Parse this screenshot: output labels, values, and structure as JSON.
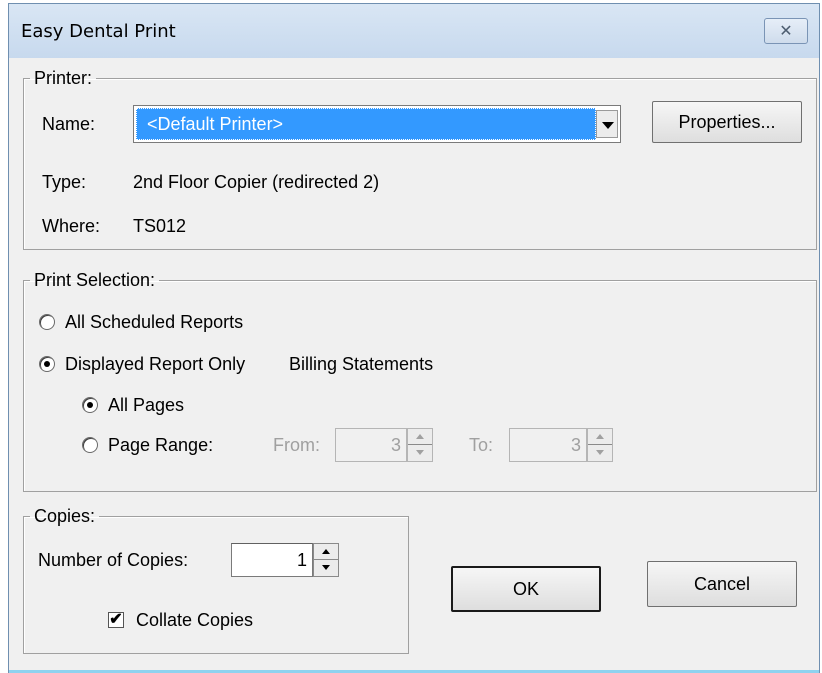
{
  "window": {
    "title": "Easy Dental Print",
    "close_glyph": "✕"
  },
  "printer": {
    "legend": "Printer:",
    "name_label": "Name:",
    "name_value": "<Default Printer>",
    "properties_label": "Properties...",
    "type_label": "Type:",
    "type_value": "2nd Floor Copier (redirected 2)",
    "where_label": "Where:",
    "where_value": "TS012"
  },
  "selection": {
    "legend": "Print Selection:",
    "all_scheduled": "All Scheduled Reports",
    "displayed_only": "Displayed Report Only",
    "report_name": "Billing Statements",
    "all_pages": "All Pages",
    "page_range": "Page Range:",
    "from_label": "From:",
    "from_value": "3",
    "to_label": "To:",
    "to_value": "3"
  },
  "copies": {
    "legend": "Copies:",
    "number_label": "Number of Copies:",
    "number_value": "1",
    "collate_label": "Collate Copies",
    "collate_checked_glyph": "✔"
  },
  "buttons": {
    "ok": "OK",
    "cancel": "Cancel"
  }
}
